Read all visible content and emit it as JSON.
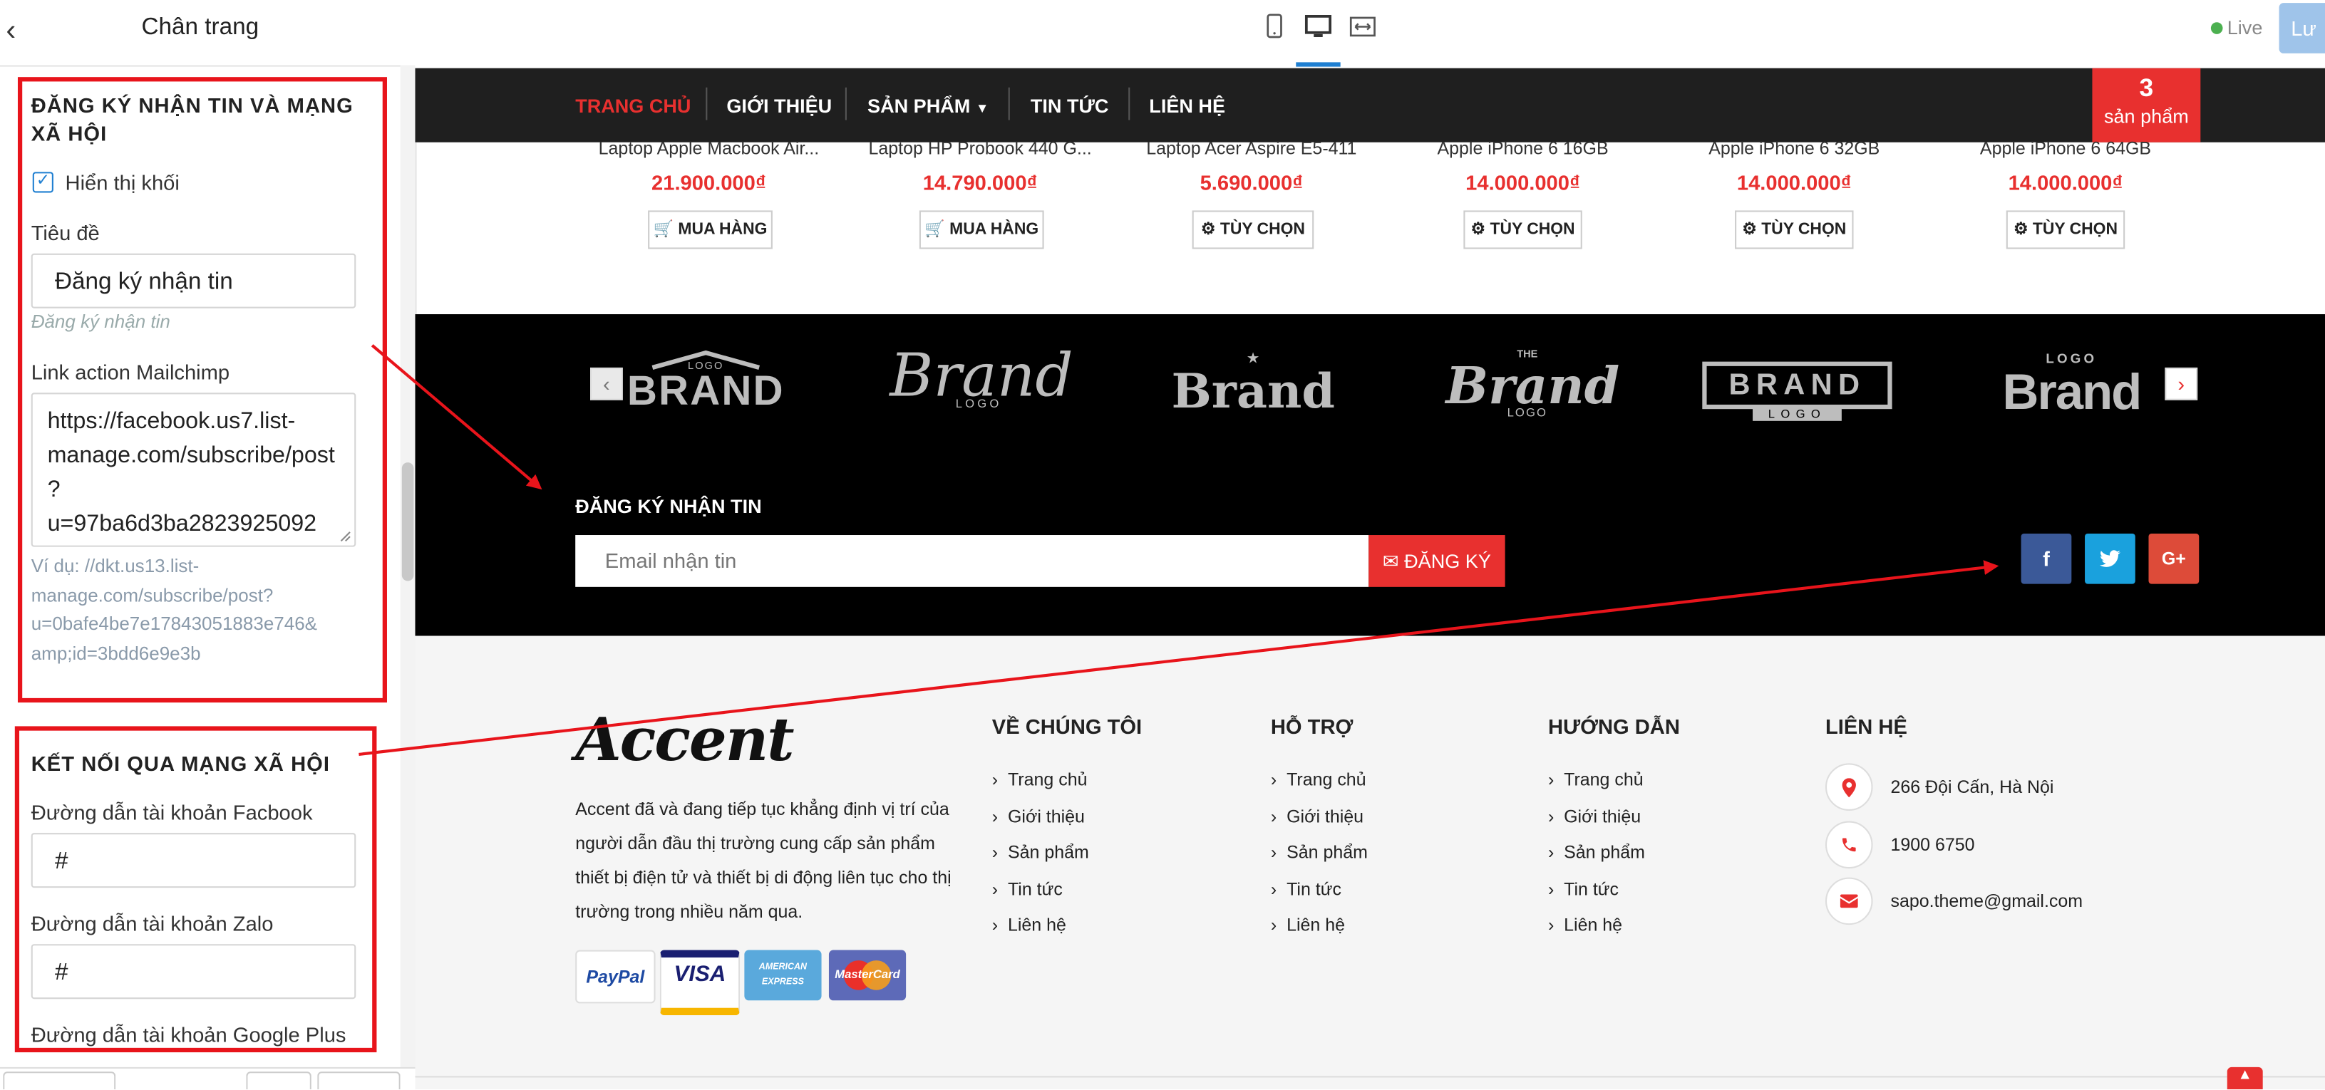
{
  "panel": {
    "title": "Chân trang",
    "newsletter_section": {
      "title_line1": "ĐĂNG KÝ NHẬN TIN VÀ MẠNG",
      "title_line2": "XÃ HỘI",
      "show_block_label": "Hiển thị khối",
      "show_block_checked": true,
      "heading_label": "Tiêu đề",
      "heading_value": "Đăng ký nhận tin",
      "heading_hint": "Đăng ký nhận tin",
      "mailchimp_label": "Link action Mailchimp",
      "mailchimp_lines": [
        "https://facebook.us7.list-",
        "manage.com/subscribe/post",
        "?",
        "u=97ba6d3ba2823925092"
      ],
      "mailchimp_hint_lines": [
        "Ví dụ: //dkt.us13.list-",
        "manage.com/subscribe/post?",
        "u=0bafe4be7e17843051883e746&",
        "amp;id=3bdd6e9e3b"
      ]
    },
    "social_section": {
      "title": "KẾT NỐI QUA MẠNG XÃ HỘI",
      "facebook_label": "Đường dẫn tài khoản Facbook",
      "facebook_value": "#",
      "zalo_label": "Đường dẫn tài khoản Zalo",
      "zalo_value": "#",
      "googleplus_label": "Đường dẫn tài khoản Google Plus"
    }
  },
  "topbar": {
    "live_label": "Live",
    "save_label": "Lư",
    "icons": [
      "tablet-icon",
      "desktop-icon",
      "fullwidth-icon"
    ]
  },
  "nav": {
    "items": [
      "TRANG CHỦ",
      "GIỚI THIỆU",
      "SẢN PHẨM",
      "TIN TỨC",
      "LIÊN HỆ"
    ],
    "active": "TRANG CHỦ",
    "cart_count": "3",
    "cart_label": "sản phẩm"
  },
  "products": [
    {
      "name": "Laptop Apple Macbook Air...",
      "price": "21.900.000₫",
      "button": "MUA HÀNG"
    },
    {
      "name": "Laptop HP Probook 440 G...",
      "price": "14.790.000₫",
      "button": "MUA HÀNG"
    },
    {
      "name": "Laptop Acer Aspire E5-411",
      "price": "5.690.000₫",
      "button": "TÙY CHỌN"
    },
    {
      "name": "Apple iPhone 6 16GB",
      "price": "14.000.000₫",
      "button": "TÙY CHỌN"
    },
    {
      "name": "Apple iPhone 6 32GB",
      "price": "14.000.000₫",
      "button": "TÙY CHỌN"
    },
    {
      "name": "Apple iPhone 6 64GB",
      "price": "14.000.000₫",
      "button": "TÙY CHỌN"
    }
  ],
  "brands": {
    "b1_top": "LOGO",
    "b1_main": "BRAND",
    "b2_main": "Brand",
    "b2_sub": "LOGO",
    "b3_main": "Brand",
    "b4_top": "THE",
    "b4_main": "Brand",
    "b4_sub": "LOGO",
    "b5_main": "BRAND",
    "b5_sub": "LOGO",
    "b6_top": "LOGO",
    "b6_main": "Brand"
  },
  "newsletter": {
    "title": "ĐĂNG KÝ NHẬN TIN",
    "placeholder": "Email nhận tin",
    "button": "ĐĂNG KÝ"
  },
  "social_buttons": [
    "f",
    "t",
    "G+"
  ],
  "footer": {
    "logo": "Accent",
    "about_lines": [
      "Accent đã và đang tiếp tục khẳng định vị trí của",
      "người dẫn đầu thị trường cung cấp sản phẩm",
      "thiết bị điện tử và thiết bị di động liên tục cho thị",
      "trường trong nhiều năm qua."
    ],
    "payments": [
      "PayPal",
      "VISA",
      "AMERICAN EXPRESS",
      "MasterCard"
    ],
    "columns": [
      {
        "title": "VỀ CHÚNG TÔI",
        "items": [
          "Trang chủ",
          "Giới thiệu",
          "Sản phẩm",
          "Tin tức",
          "Liên hệ"
        ]
      },
      {
        "title": "HỖ TRỢ",
        "items": [
          "Trang chủ",
          "Giới thiệu",
          "Sản phẩm",
          "Tin tức",
          "Liên hệ"
        ]
      },
      {
        "title": "HƯỚNG DẪN",
        "items": [
          "Trang chủ",
          "Giới thiệu",
          "Sản phẩm",
          "Tin tức",
          "Liên hệ"
        ]
      }
    ],
    "contact_title": "LIÊN HỆ",
    "contact": {
      "address": "266 Đội Cấn, Hà Nội",
      "phone": "1900 6750",
      "email": "sapo.theme@gmail.com"
    }
  },
  "colors": {
    "accent": "#e8302f",
    "annotation": "#e8141b",
    "facebook": "#3b5998",
    "twitter": "#1da1f2",
    "googleplus": "#dd4b39"
  }
}
